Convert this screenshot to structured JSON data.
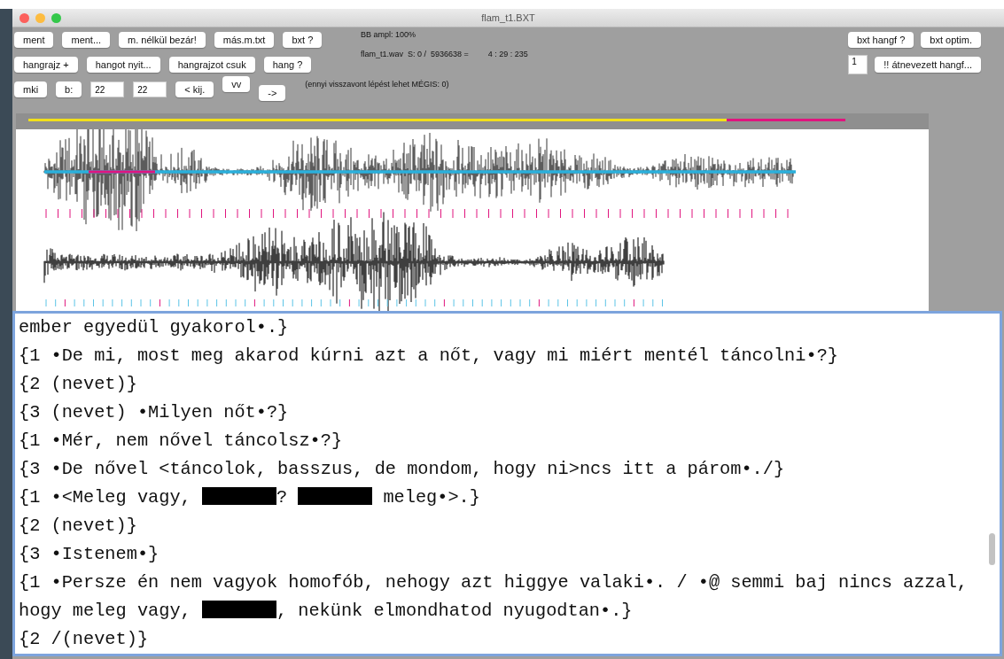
{
  "window": {
    "title": "flam_t1.BXT"
  },
  "toolbar": {
    "rows": [
      {
        "controls": [
          {
            "kind": "button",
            "label": "ment"
          },
          {
            "kind": "button",
            "label": "ment..."
          },
          {
            "kind": "button",
            "label": "m. nélkül bezár!"
          },
          {
            "kind": "button",
            "label": "más.m.txt"
          },
          {
            "kind": "button",
            "label": "bxt ?"
          }
        ]
      },
      {
        "controls": [
          {
            "kind": "button",
            "label": "hangrajz +"
          },
          {
            "kind": "button",
            "label": "hangot nyit..."
          },
          {
            "kind": "button",
            "label": "hangrajzot csuk"
          },
          {
            "kind": "button",
            "label": "hang ?"
          }
        ]
      },
      {
        "controls": [
          {
            "kind": "button",
            "label": "mki"
          },
          {
            "kind": "button",
            "label": "b:"
          },
          {
            "kind": "input",
            "value": "22"
          },
          {
            "kind": "input",
            "value": "22"
          },
          {
            "kind": "button",
            "label": "< kij."
          },
          {
            "kind": "raised-button",
            "label": "vv"
          },
          {
            "kind": "lowered-button",
            "label": "->"
          }
        ]
      }
    ],
    "status": {
      "amplitude": "BB ampl: 100%",
      "file_position": "flam_t1.wav  S: 0 /  5936638 =",
      "time": "4 : 29 : 235",
      "undo_note": "(ennyi visszavont lépést lehet MÉGIS: 0)"
    },
    "right_rows": [
      [
        {
          "kind": "button",
          "label": "bxt hangf ?"
        },
        {
          "kind": "button",
          "label": "bxt optim."
        }
      ],
      [
        {
          "kind": "input",
          "value": "1"
        },
        {
          "kind": "button",
          "label": "!! átnevezett hangf..."
        }
      ]
    ]
  },
  "transcript": {
    "lines": [
      {
        "segments": [
          {
            "kind": "text",
            "text": "ember egyedül gyakorol•.}"
          }
        ]
      },
      {
        "segments": [
          {
            "kind": "text",
            "text": "{1 •De mi, most meg akarod kúrni azt a nőt, vagy mi miért mentél táncolni•?}"
          }
        ]
      },
      {
        "segments": [
          {
            "kind": "text",
            "text": "{2 (nevet)}"
          }
        ]
      },
      {
        "segments": [
          {
            "kind": "text",
            "text": "{3 (nevet) •Milyen nőt•?}"
          }
        ]
      },
      {
        "segments": [
          {
            "kind": "text",
            "text": "{1 •Mér, nem nővel táncolsz•?}"
          }
        ]
      },
      {
        "segments": [
          {
            "kind": "text",
            "text": "{3 •De nővel <táncolok, basszus, de mondom, hogy ni>ncs itt a párom•./}"
          }
        ]
      },
      {
        "segments": [
          {
            "kind": "text",
            "text": "{1 •<Meleg vagy, "
          },
          {
            "kind": "redacted"
          },
          {
            "kind": "text",
            "text": "? "
          },
          {
            "kind": "redacted"
          },
          {
            "kind": "text",
            "text": " meleg•>.}"
          }
        ]
      },
      {
        "segments": [
          {
            "kind": "text",
            "text": "{2 (nevet)}"
          }
        ]
      },
      {
        "segments": [
          {
            "kind": "text",
            "text": "{3 •Istenem•}"
          }
        ]
      },
      {
        "segments": [
          {
            "kind": "text",
            "text": "{1 •Persze én nem vagyok homofób, nehogy azt higgye valaki•. / •@ semmi baj nincs azzal,"
          }
        ]
      },
      {
        "segments": [
          {
            "kind": "text",
            "text": "hogy meleg vagy, "
          },
          {
            "kind": "redacted"
          },
          {
            "kind": "text",
            "text": ", nekünk elmondhatod nyugodtan•.}"
          }
        ]
      },
      {
        "segments": [
          {
            "kind": "text",
            "text": "{2 /(nevet)}"
          }
        ]
      }
    ]
  }
}
